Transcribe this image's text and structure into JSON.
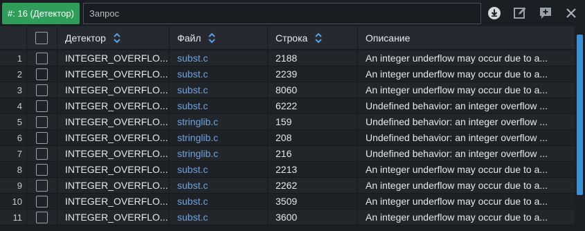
{
  "toolbar": {
    "badge": "#: 16 (Детектор)",
    "search_placeholder": "Запрос",
    "icons": [
      "download-icon",
      "edit-icon",
      "comment-add-icon",
      "close-icon"
    ]
  },
  "table": {
    "headers": {
      "detector": "Детектор",
      "file": "Файл",
      "line": "Строка",
      "description": "Описание"
    },
    "rows": [
      {
        "n": "1",
        "detector": "INTEGER_OVERFLO...",
        "file": "subst.c",
        "line": "2188",
        "desc": "An integer underflow may occur due to a..."
      },
      {
        "n": "2",
        "detector": "INTEGER_OVERFLO...",
        "file": "subst.c",
        "line": "2239",
        "desc": "An integer underflow may occur due to a..."
      },
      {
        "n": "3",
        "detector": "INTEGER_OVERFLO...",
        "file": "subst.c",
        "line": "8060",
        "desc": "An integer underflow may occur due to a..."
      },
      {
        "n": "4",
        "detector": "INTEGER_OVERFLO...",
        "file": "subst.c",
        "line": "6222",
        "desc": "Undefined behavior: an integer overflow ..."
      },
      {
        "n": "5",
        "detector": "INTEGER_OVERFLO...",
        "file": "stringlib.c",
        "line": "159",
        "desc": "Undefined behavior: an integer overflow ..."
      },
      {
        "n": "6",
        "detector": "INTEGER_OVERFLO...",
        "file": "stringlib.c",
        "line": "208",
        "desc": "Undefined behavior: an integer overflow ..."
      },
      {
        "n": "7",
        "detector": "INTEGER_OVERFLO...",
        "file": "stringlib.c",
        "line": "216",
        "desc": "Undefined behavior: an integer overflow ..."
      },
      {
        "n": "8",
        "detector": "INTEGER_OVERFLO...",
        "file": "subst.c",
        "line": "2213",
        "desc": "An integer underflow may occur due to a..."
      },
      {
        "n": "9",
        "detector": "INTEGER_OVERFLO...",
        "file": "subst.c",
        "line": "2262",
        "desc": "An integer underflow may occur due to a..."
      },
      {
        "n": "10",
        "detector": "INTEGER_OVERFLO...",
        "file": "subst.c",
        "line": "3509",
        "desc": "An integer underflow may occur due to a..."
      },
      {
        "n": "11",
        "detector": "INTEGER_OVERFLO...",
        "file": "subst.c",
        "line": "3600",
        "desc": "An integer underflow may occur due to a..."
      }
    ]
  },
  "colors": {
    "badge": "#2e9e5a",
    "row_odd": "#22262b",
    "row_even": "#1e2125",
    "link": "#6fa3e0",
    "sort_icon": "#5aa0e6",
    "scrollbar": "#3d8fd6"
  }
}
